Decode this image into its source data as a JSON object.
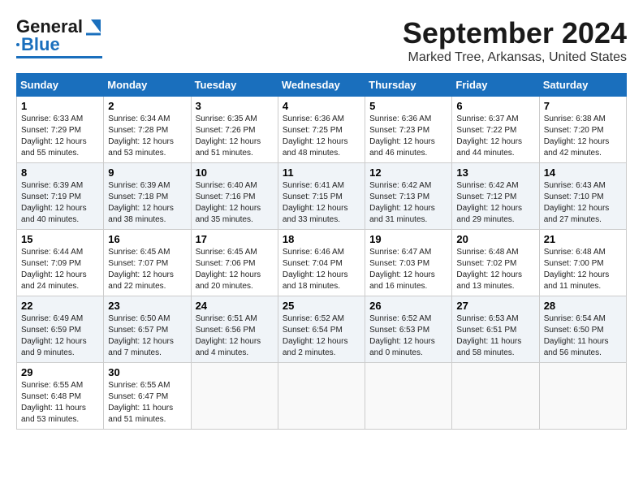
{
  "header": {
    "logo_general": "General",
    "logo_blue": "Blue",
    "month_title": "September 2024",
    "location": "Marked Tree, Arkansas, United States"
  },
  "columns": [
    "Sunday",
    "Monday",
    "Tuesday",
    "Wednesday",
    "Thursday",
    "Friday",
    "Saturday"
  ],
  "weeks": [
    [
      {
        "day": "1",
        "sunrise": "Sunrise: 6:33 AM",
        "sunset": "Sunset: 7:29 PM",
        "daylight": "Daylight: 12 hours and 55 minutes."
      },
      {
        "day": "2",
        "sunrise": "Sunrise: 6:34 AM",
        "sunset": "Sunset: 7:28 PM",
        "daylight": "Daylight: 12 hours and 53 minutes."
      },
      {
        "day": "3",
        "sunrise": "Sunrise: 6:35 AM",
        "sunset": "Sunset: 7:26 PM",
        "daylight": "Daylight: 12 hours and 51 minutes."
      },
      {
        "day": "4",
        "sunrise": "Sunrise: 6:36 AM",
        "sunset": "Sunset: 7:25 PM",
        "daylight": "Daylight: 12 hours and 48 minutes."
      },
      {
        "day": "5",
        "sunrise": "Sunrise: 6:36 AM",
        "sunset": "Sunset: 7:23 PM",
        "daylight": "Daylight: 12 hours and 46 minutes."
      },
      {
        "day": "6",
        "sunrise": "Sunrise: 6:37 AM",
        "sunset": "Sunset: 7:22 PM",
        "daylight": "Daylight: 12 hours and 44 minutes."
      },
      {
        "day": "7",
        "sunrise": "Sunrise: 6:38 AM",
        "sunset": "Sunset: 7:20 PM",
        "daylight": "Daylight: 12 hours and 42 minutes."
      }
    ],
    [
      {
        "day": "8",
        "sunrise": "Sunrise: 6:39 AM",
        "sunset": "Sunset: 7:19 PM",
        "daylight": "Daylight: 12 hours and 40 minutes."
      },
      {
        "day": "9",
        "sunrise": "Sunrise: 6:39 AM",
        "sunset": "Sunset: 7:18 PM",
        "daylight": "Daylight: 12 hours and 38 minutes."
      },
      {
        "day": "10",
        "sunrise": "Sunrise: 6:40 AM",
        "sunset": "Sunset: 7:16 PM",
        "daylight": "Daylight: 12 hours and 35 minutes."
      },
      {
        "day": "11",
        "sunrise": "Sunrise: 6:41 AM",
        "sunset": "Sunset: 7:15 PM",
        "daylight": "Daylight: 12 hours and 33 minutes."
      },
      {
        "day": "12",
        "sunrise": "Sunrise: 6:42 AM",
        "sunset": "Sunset: 7:13 PM",
        "daylight": "Daylight: 12 hours and 31 minutes."
      },
      {
        "day": "13",
        "sunrise": "Sunrise: 6:42 AM",
        "sunset": "Sunset: 7:12 PM",
        "daylight": "Daylight: 12 hours and 29 minutes."
      },
      {
        "day": "14",
        "sunrise": "Sunrise: 6:43 AM",
        "sunset": "Sunset: 7:10 PM",
        "daylight": "Daylight: 12 hours and 27 minutes."
      }
    ],
    [
      {
        "day": "15",
        "sunrise": "Sunrise: 6:44 AM",
        "sunset": "Sunset: 7:09 PM",
        "daylight": "Daylight: 12 hours and 24 minutes."
      },
      {
        "day": "16",
        "sunrise": "Sunrise: 6:45 AM",
        "sunset": "Sunset: 7:07 PM",
        "daylight": "Daylight: 12 hours and 22 minutes."
      },
      {
        "day": "17",
        "sunrise": "Sunrise: 6:45 AM",
        "sunset": "Sunset: 7:06 PM",
        "daylight": "Daylight: 12 hours and 20 minutes."
      },
      {
        "day": "18",
        "sunrise": "Sunrise: 6:46 AM",
        "sunset": "Sunset: 7:04 PM",
        "daylight": "Daylight: 12 hours and 18 minutes."
      },
      {
        "day": "19",
        "sunrise": "Sunrise: 6:47 AM",
        "sunset": "Sunset: 7:03 PM",
        "daylight": "Daylight: 12 hours and 16 minutes."
      },
      {
        "day": "20",
        "sunrise": "Sunrise: 6:48 AM",
        "sunset": "Sunset: 7:02 PM",
        "daylight": "Daylight: 12 hours and 13 minutes."
      },
      {
        "day": "21",
        "sunrise": "Sunrise: 6:48 AM",
        "sunset": "Sunset: 7:00 PM",
        "daylight": "Daylight: 12 hours and 11 minutes."
      }
    ],
    [
      {
        "day": "22",
        "sunrise": "Sunrise: 6:49 AM",
        "sunset": "Sunset: 6:59 PM",
        "daylight": "Daylight: 12 hours and 9 minutes."
      },
      {
        "day": "23",
        "sunrise": "Sunrise: 6:50 AM",
        "sunset": "Sunset: 6:57 PM",
        "daylight": "Daylight: 12 hours and 7 minutes."
      },
      {
        "day": "24",
        "sunrise": "Sunrise: 6:51 AM",
        "sunset": "Sunset: 6:56 PM",
        "daylight": "Daylight: 12 hours and 4 minutes."
      },
      {
        "day": "25",
        "sunrise": "Sunrise: 6:52 AM",
        "sunset": "Sunset: 6:54 PM",
        "daylight": "Daylight: 12 hours and 2 minutes."
      },
      {
        "day": "26",
        "sunrise": "Sunrise: 6:52 AM",
        "sunset": "Sunset: 6:53 PM",
        "daylight": "Daylight: 12 hours and 0 minutes."
      },
      {
        "day": "27",
        "sunrise": "Sunrise: 6:53 AM",
        "sunset": "Sunset: 6:51 PM",
        "daylight": "Daylight: 11 hours and 58 minutes."
      },
      {
        "day": "28",
        "sunrise": "Sunrise: 6:54 AM",
        "sunset": "Sunset: 6:50 PM",
        "daylight": "Daylight: 11 hours and 56 minutes."
      }
    ],
    [
      {
        "day": "29",
        "sunrise": "Sunrise: 6:55 AM",
        "sunset": "Sunset: 6:48 PM",
        "daylight": "Daylight: 11 hours and 53 minutes."
      },
      {
        "day": "30",
        "sunrise": "Sunrise: 6:55 AM",
        "sunset": "Sunset: 6:47 PM",
        "daylight": "Daylight: 11 hours and 51 minutes."
      },
      null,
      null,
      null,
      null,
      null
    ]
  ]
}
